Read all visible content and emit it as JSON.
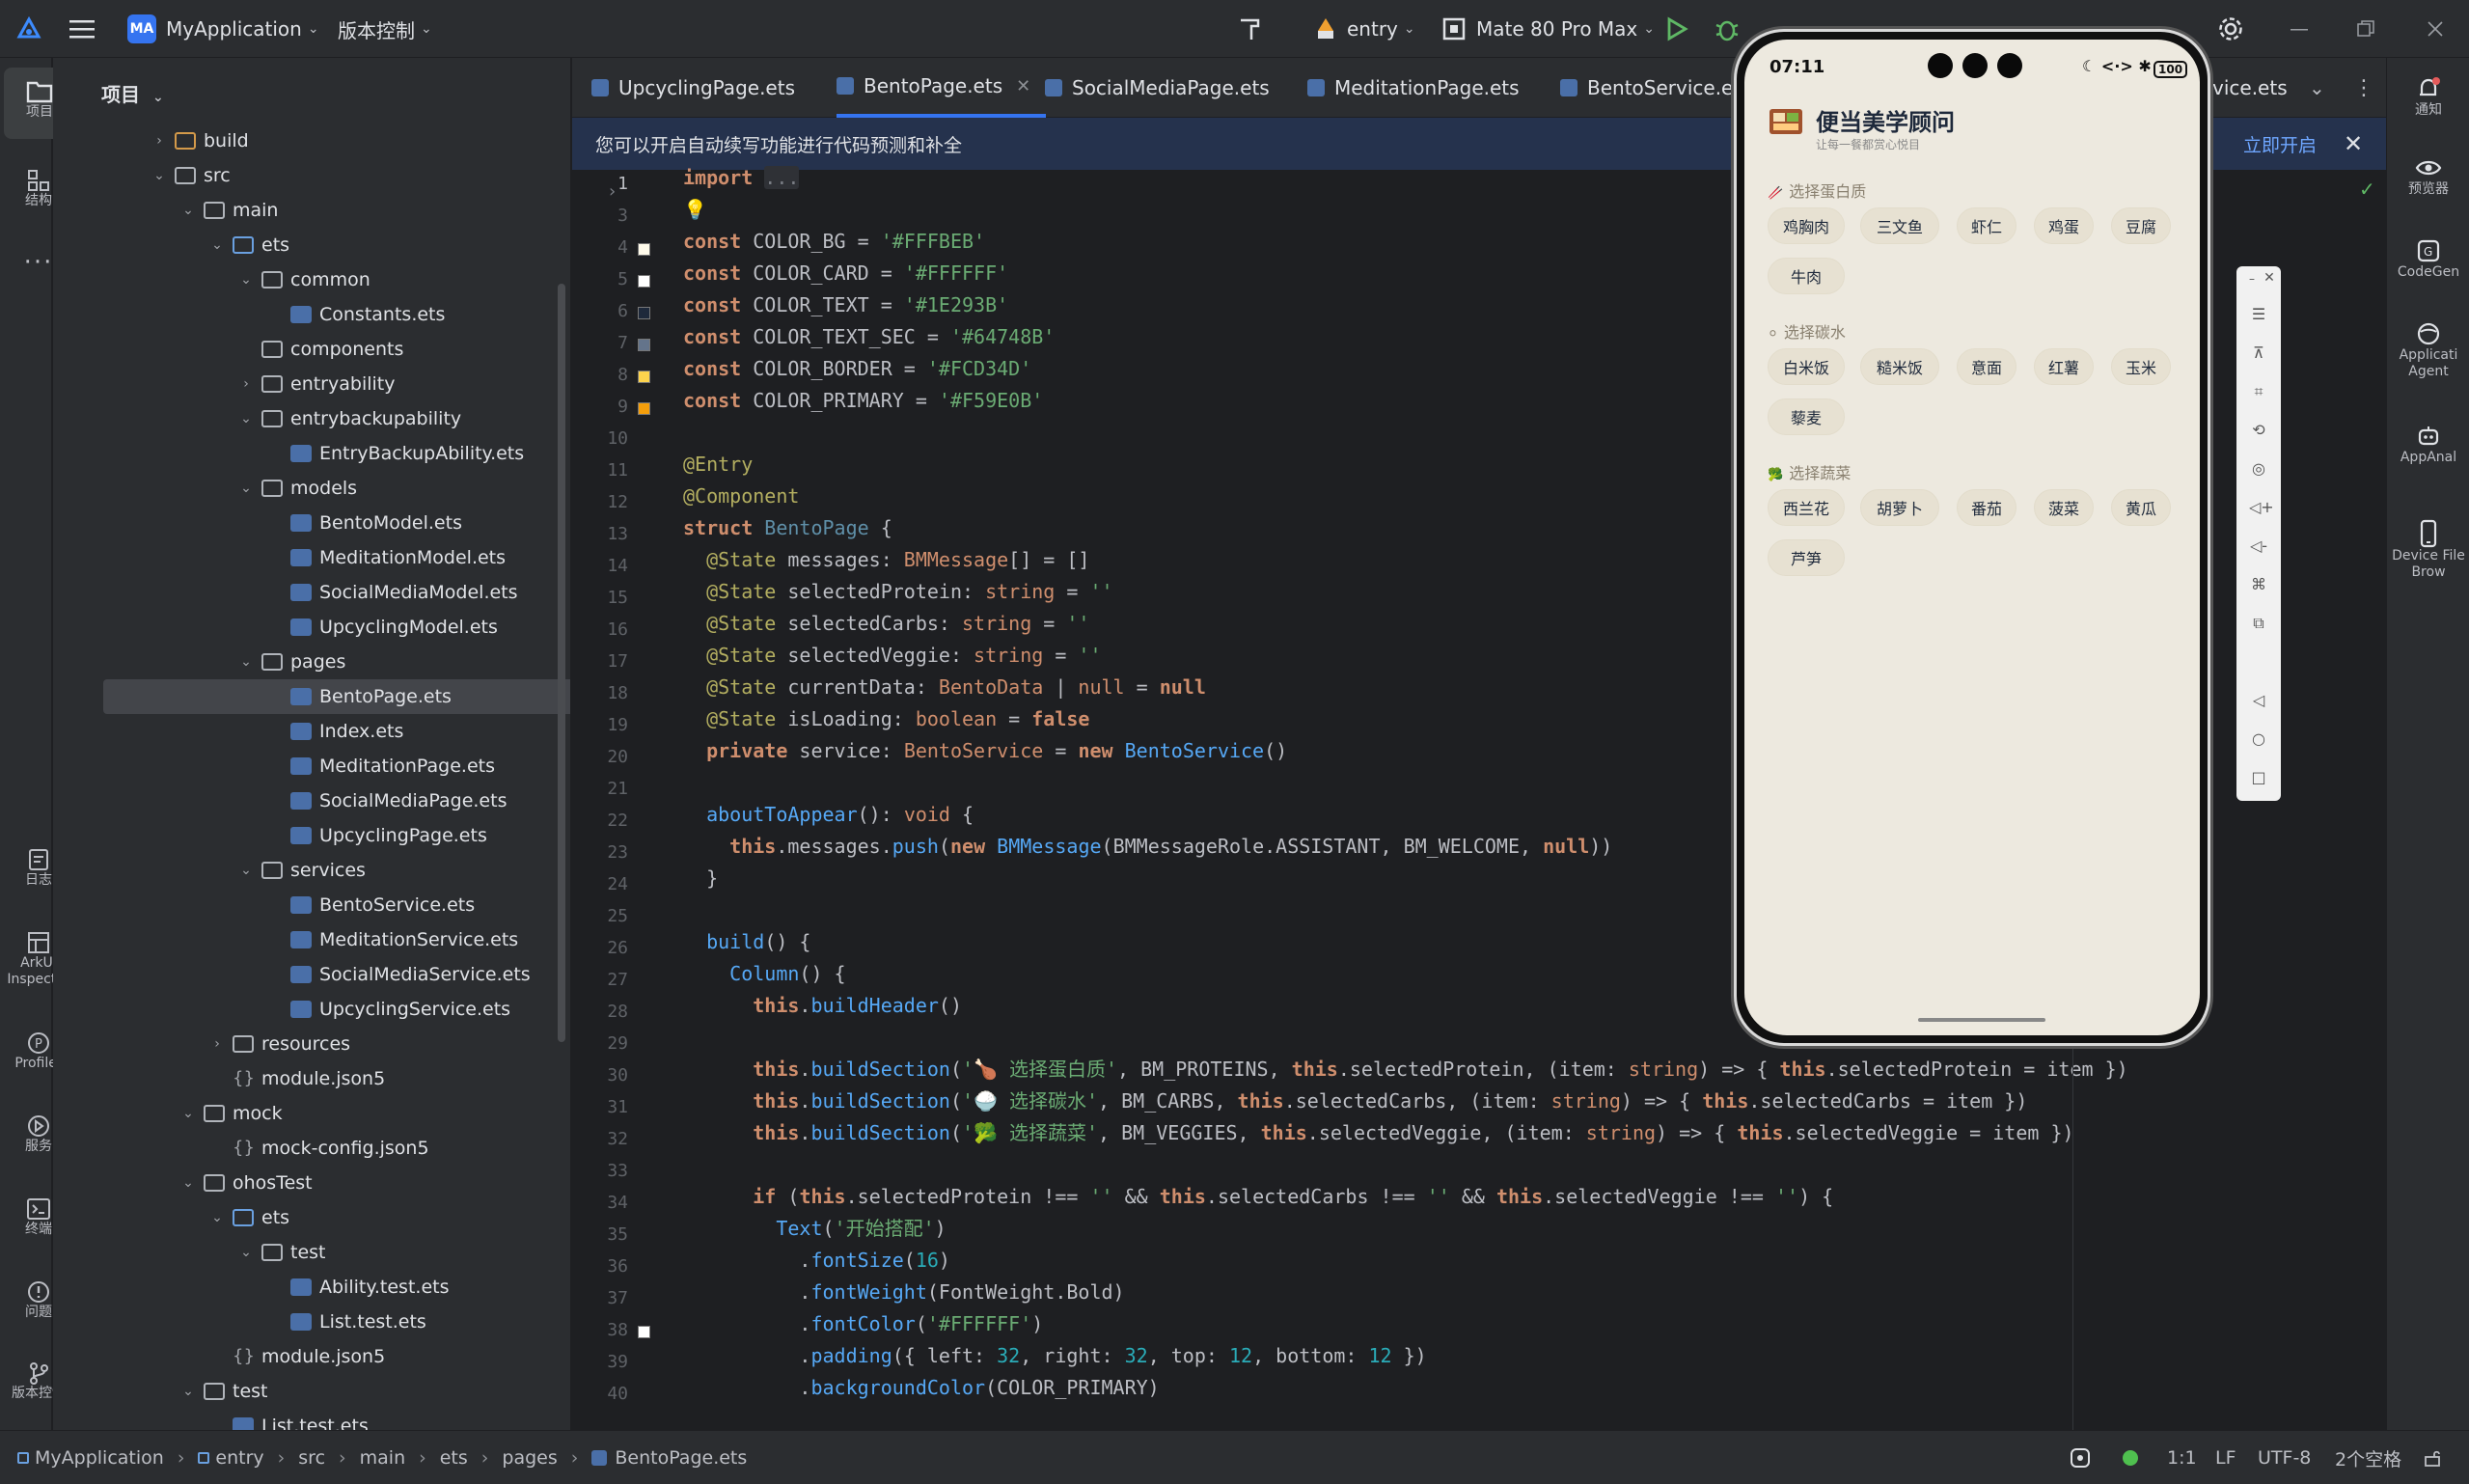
{
  "titlebar": {
    "project_badge": "MA",
    "project_name": "MyApplication",
    "vcs": "版本控制",
    "module": "entry",
    "device": "Mate 80 Pro Max"
  },
  "left_strip": [
    {
      "label": "项目"
    },
    {
      "label": "结构"
    },
    {
      "label": "日志"
    },
    {
      "label": "ArkUI Inspector"
    },
    {
      "label": "Profiler"
    },
    {
      "label": "服务"
    },
    {
      "label": "终端"
    },
    {
      "label": "问题"
    },
    {
      "label": "版本控制"
    }
  ],
  "project_panel": {
    "title": "项目",
    "tree": [
      {
        "label": "build",
        "depth": 2,
        "arrow": "›",
        "icon": "folder-build"
      },
      {
        "label": "src",
        "depth": 2,
        "arrow": "⌄",
        "icon": "folder"
      },
      {
        "label": "main",
        "depth": 3,
        "arrow": "⌄",
        "icon": "folder"
      },
      {
        "label": "ets",
        "depth": 4,
        "arrow": "⌄",
        "icon": "folder-src"
      },
      {
        "label": "common",
        "depth": 5,
        "arrow": "⌄",
        "icon": "folder"
      },
      {
        "label": "Constants.ets",
        "depth": 6,
        "arrow": "",
        "icon": "ets"
      },
      {
        "label": "components",
        "depth": 5,
        "arrow": "",
        "icon": "folder"
      },
      {
        "label": "entryability",
        "depth": 5,
        "arrow": "›",
        "icon": "folder"
      },
      {
        "label": "entrybackupability",
        "depth": 5,
        "arrow": "⌄",
        "icon": "folder"
      },
      {
        "label": "EntryBackupAbility.ets",
        "depth": 6,
        "arrow": "",
        "icon": "ets"
      },
      {
        "label": "models",
        "depth": 5,
        "arrow": "⌄",
        "icon": "folder"
      },
      {
        "label": "BentoModel.ets",
        "depth": 6,
        "arrow": "",
        "icon": "ets"
      },
      {
        "label": "MeditationModel.ets",
        "depth": 6,
        "arrow": "",
        "icon": "ets"
      },
      {
        "label": "SocialMediaModel.ets",
        "depth": 6,
        "arrow": "",
        "icon": "ets"
      },
      {
        "label": "UpcyclingModel.ets",
        "depth": 6,
        "arrow": "",
        "icon": "ets"
      },
      {
        "label": "pages",
        "depth": 5,
        "arrow": "⌄",
        "icon": "folder"
      },
      {
        "label": "BentoPage.ets",
        "depth": 6,
        "arrow": "",
        "icon": "ets",
        "selected": true
      },
      {
        "label": "Index.ets",
        "depth": 6,
        "arrow": "",
        "icon": "ets"
      },
      {
        "label": "MeditationPage.ets",
        "depth": 6,
        "arrow": "",
        "icon": "ets"
      },
      {
        "label": "SocialMediaPage.ets",
        "depth": 6,
        "arrow": "",
        "icon": "ets"
      },
      {
        "label": "UpcyclingPage.ets",
        "depth": 6,
        "arrow": "",
        "icon": "ets"
      },
      {
        "label": "services",
        "depth": 5,
        "arrow": "⌄",
        "icon": "folder"
      },
      {
        "label": "BentoService.ets",
        "depth": 6,
        "arrow": "",
        "icon": "ets"
      },
      {
        "label": "MeditationService.ets",
        "depth": 6,
        "arrow": "",
        "icon": "ets"
      },
      {
        "label": "SocialMediaService.ets",
        "depth": 6,
        "arrow": "",
        "icon": "ets"
      },
      {
        "label": "UpcyclingService.ets",
        "depth": 6,
        "arrow": "",
        "icon": "ets"
      },
      {
        "label": "resources",
        "depth": 4,
        "arrow": "›",
        "icon": "folder"
      },
      {
        "label": "module.json5",
        "depth": 4,
        "arrow": "",
        "icon": "json"
      },
      {
        "label": "mock",
        "depth": 3,
        "arrow": "⌄",
        "icon": "folder"
      },
      {
        "label": "mock-config.json5",
        "depth": 4,
        "arrow": "",
        "icon": "json"
      },
      {
        "label": "ohosTest",
        "depth": 3,
        "arrow": "⌄",
        "icon": "folder"
      },
      {
        "label": "ets",
        "depth": 4,
        "arrow": "⌄",
        "icon": "folder-src"
      },
      {
        "label": "test",
        "depth": 5,
        "arrow": "⌄",
        "icon": "folder"
      },
      {
        "label": "Ability.test.ets",
        "depth": 6,
        "arrow": "",
        "icon": "ets"
      },
      {
        "label": "List.test.ets",
        "depth": 6,
        "arrow": "",
        "icon": "ets"
      },
      {
        "label": "module.json5",
        "depth": 4,
        "arrow": "",
        "icon": "json"
      },
      {
        "label": "test",
        "depth": 3,
        "arrow": "⌄",
        "icon": "folder"
      },
      {
        "label": "List.test.ets",
        "depth": 4,
        "arrow": "",
        "icon": "ets"
      }
    ]
  },
  "tabs": [
    {
      "label": "UpcyclingPage.ets"
    },
    {
      "label": "BentoPage.ets",
      "active": true
    },
    {
      "label": "SocialMediaPage.ets"
    },
    {
      "label": "MeditationPage.ets"
    },
    {
      "label": "BentoService.ets"
    },
    {
      "label": "vice.ets"
    }
  ],
  "banner": {
    "text": "您可以开启自动续写功能进行代码预测和补全",
    "link": "立即开启"
  },
  "gutter": {
    "line_numbers": [
      "1",
      "3",
      "4",
      "5",
      "6",
      "7",
      "8",
      "9",
      "10",
      "11",
      "12",
      "13",
      "14",
      "15",
      "16",
      "17",
      "18",
      "19",
      "20",
      "21",
      "22",
      "23",
      "24",
      "25",
      "26",
      "27",
      "28",
      "29",
      "30",
      "31",
      "32",
      "33",
      "34",
      "35",
      "36",
      "37",
      "38",
      "39",
      "40"
    ],
    "swatches": [
      {
        "row": 2,
        "color": "#FFFBEB"
      },
      {
        "row": 3,
        "color": "#FFFFFF"
      },
      {
        "row": 4,
        "color": "#1E293B"
      },
      {
        "row": 5,
        "color": "#64748B"
      },
      {
        "row": 6,
        "color": "#FCD34D"
      },
      {
        "row": 7,
        "color": "#F59E0B"
      },
      {
        "row": 36,
        "color": "#FFFFFF"
      }
    ]
  },
  "phone": {
    "time": "07:11",
    "battery": "100",
    "title": "便当美学顾问",
    "subtitle": "让每一餐都赏心悦目",
    "sections": [
      {
        "label": "选择蛋白质",
        "icon": "🥢",
        "items": [
          "鸡胸肉",
          "三文鱼",
          "虾仁",
          "鸡蛋",
          "豆腐",
          "牛肉"
        ]
      },
      {
        "label": "选择碳水",
        "icon": "⚪",
        "items": [
          "白米饭",
          "糙米饭",
          "意面",
          "红薯",
          "玉米",
          "藜麦"
        ]
      },
      {
        "label": "选择蔬菜",
        "icon": "🥦",
        "items": [
          "西兰花",
          "胡萝卜",
          "番茄",
          "菠菜",
          "黄瓜",
          "芦笋"
        ]
      }
    ]
  },
  "right_strip": [
    {
      "label": "通知"
    },
    {
      "label": "预览器"
    },
    {
      "label": "CodeGen"
    },
    {
      "label": "Applicati Agent"
    },
    {
      "label": "AppAnal"
    },
    {
      "label": "Device File Brow"
    }
  ],
  "statusbar": {
    "breadcrumb": [
      "MyApplication",
      "entry",
      "src",
      "main",
      "ets",
      "pages",
      "BentoPage.ets"
    ],
    "position": "1:1",
    "line_ending": "LF",
    "encoding": "UTF-8",
    "indent": "2个空格"
  },
  "colors": {
    "accent": "#3574f0",
    "bg": "#1e1f22",
    "panel": "#2b2d30",
    "phone_bg": "#ede9df"
  }
}
